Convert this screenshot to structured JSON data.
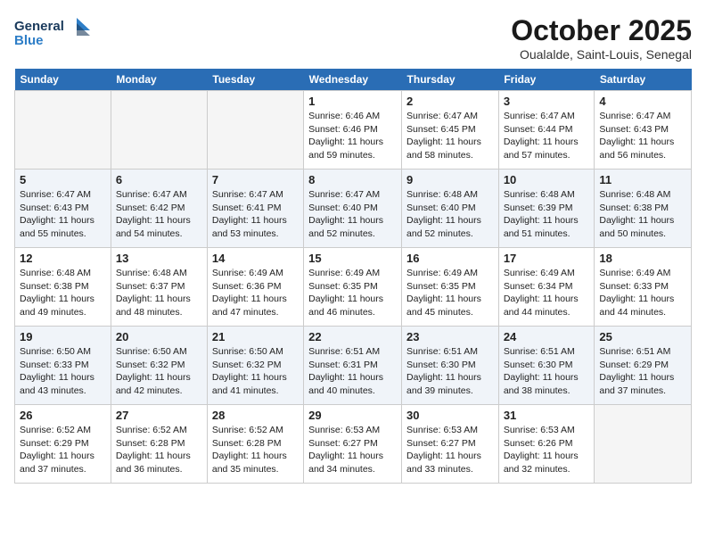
{
  "header": {
    "logo_line1": "General",
    "logo_line2": "Blue",
    "title": "October 2025",
    "subtitle": "Oualalde, Saint-Louis, Senegal"
  },
  "weekdays": [
    "Sunday",
    "Monday",
    "Tuesday",
    "Wednesday",
    "Thursday",
    "Friday",
    "Saturday"
  ],
  "weeks": [
    [
      {
        "day": "",
        "info": ""
      },
      {
        "day": "",
        "info": ""
      },
      {
        "day": "",
        "info": ""
      },
      {
        "day": "1",
        "info": "Sunrise: 6:46 AM\nSunset: 6:46 PM\nDaylight: 11 hours\nand 59 minutes."
      },
      {
        "day": "2",
        "info": "Sunrise: 6:47 AM\nSunset: 6:45 PM\nDaylight: 11 hours\nand 58 minutes."
      },
      {
        "day": "3",
        "info": "Sunrise: 6:47 AM\nSunset: 6:44 PM\nDaylight: 11 hours\nand 57 minutes."
      },
      {
        "day": "4",
        "info": "Sunrise: 6:47 AM\nSunset: 6:43 PM\nDaylight: 11 hours\nand 56 minutes."
      }
    ],
    [
      {
        "day": "5",
        "info": "Sunrise: 6:47 AM\nSunset: 6:43 PM\nDaylight: 11 hours\nand 55 minutes."
      },
      {
        "day": "6",
        "info": "Sunrise: 6:47 AM\nSunset: 6:42 PM\nDaylight: 11 hours\nand 54 minutes."
      },
      {
        "day": "7",
        "info": "Sunrise: 6:47 AM\nSunset: 6:41 PM\nDaylight: 11 hours\nand 53 minutes."
      },
      {
        "day": "8",
        "info": "Sunrise: 6:47 AM\nSunset: 6:40 PM\nDaylight: 11 hours\nand 52 minutes."
      },
      {
        "day": "9",
        "info": "Sunrise: 6:48 AM\nSunset: 6:40 PM\nDaylight: 11 hours\nand 52 minutes."
      },
      {
        "day": "10",
        "info": "Sunrise: 6:48 AM\nSunset: 6:39 PM\nDaylight: 11 hours\nand 51 minutes."
      },
      {
        "day": "11",
        "info": "Sunrise: 6:48 AM\nSunset: 6:38 PM\nDaylight: 11 hours\nand 50 minutes."
      }
    ],
    [
      {
        "day": "12",
        "info": "Sunrise: 6:48 AM\nSunset: 6:38 PM\nDaylight: 11 hours\nand 49 minutes."
      },
      {
        "day": "13",
        "info": "Sunrise: 6:48 AM\nSunset: 6:37 PM\nDaylight: 11 hours\nand 48 minutes."
      },
      {
        "day": "14",
        "info": "Sunrise: 6:49 AM\nSunset: 6:36 PM\nDaylight: 11 hours\nand 47 minutes."
      },
      {
        "day": "15",
        "info": "Sunrise: 6:49 AM\nSunset: 6:35 PM\nDaylight: 11 hours\nand 46 minutes."
      },
      {
        "day": "16",
        "info": "Sunrise: 6:49 AM\nSunset: 6:35 PM\nDaylight: 11 hours\nand 45 minutes."
      },
      {
        "day": "17",
        "info": "Sunrise: 6:49 AM\nSunset: 6:34 PM\nDaylight: 11 hours\nand 44 minutes."
      },
      {
        "day": "18",
        "info": "Sunrise: 6:49 AM\nSunset: 6:33 PM\nDaylight: 11 hours\nand 44 minutes."
      }
    ],
    [
      {
        "day": "19",
        "info": "Sunrise: 6:50 AM\nSunset: 6:33 PM\nDaylight: 11 hours\nand 43 minutes."
      },
      {
        "day": "20",
        "info": "Sunrise: 6:50 AM\nSunset: 6:32 PM\nDaylight: 11 hours\nand 42 minutes."
      },
      {
        "day": "21",
        "info": "Sunrise: 6:50 AM\nSunset: 6:32 PM\nDaylight: 11 hours\nand 41 minutes."
      },
      {
        "day": "22",
        "info": "Sunrise: 6:51 AM\nSunset: 6:31 PM\nDaylight: 11 hours\nand 40 minutes."
      },
      {
        "day": "23",
        "info": "Sunrise: 6:51 AM\nSunset: 6:30 PM\nDaylight: 11 hours\nand 39 minutes."
      },
      {
        "day": "24",
        "info": "Sunrise: 6:51 AM\nSunset: 6:30 PM\nDaylight: 11 hours\nand 38 minutes."
      },
      {
        "day": "25",
        "info": "Sunrise: 6:51 AM\nSunset: 6:29 PM\nDaylight: 11 hours\nand 37 minutes."
      }
    ],
    [
      {
        "day": "26",
        "info": "Sunrise: 6:52 AM\nSunset: 6:29 PM\nDaylight: 11 hours\nand 37 minutes."
      },
      {
        "day": "27",
        "info": "Sunrise: 6:52 AM\nSunset: 6:28 PM\nDaylight: 11 hours\nand 36 minutes."
      },
      {
        "day": "28",
        "info": "Sunrise: 6:52 AM\nSunset: 6:28 PM\nDaylight: 11 hours\nand 35 minutes."
      },
      {
        "day": "29",
        "info": "Sunrise: 6:53 AM\nSunset: 6:27 PM\nDaylight: 11 hours\nand 34 minutes."
      },
      {
        "day": "30",
        "info": "Sunrise: 6:53 AM\nSunset: 6:27 PM\nDaylight: 11 hours\nand 33 minutes."
      },
      {
        "day": "31",
        "info": "Sunrise: 6:53 AM\nSunset: 6:26 PM\nDaylight: 11 hours\nand 32 minutes."
      },
      {
        "day": "",
        "info": ""
      }
    ]
  ]
}
